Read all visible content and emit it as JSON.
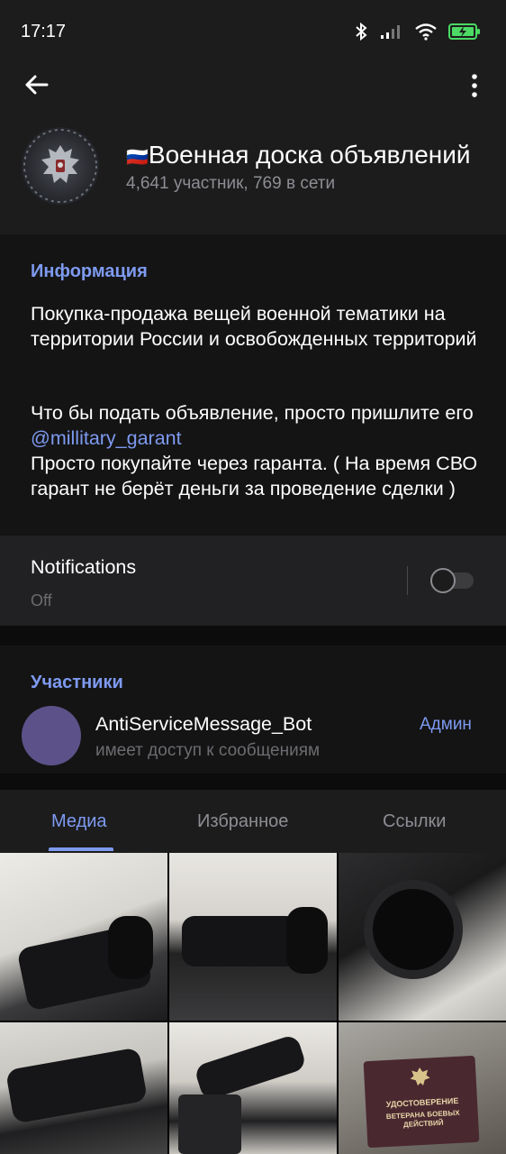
{
  "status_bar": {
    "time": "17:17",
    "icons": [
      "bluetooth-icon",
      "signal-icon",
      "wifi-icon",
      "battery-charging-icon"
    ]
  },
  "header": {
    "back_icon": "arrow-left-icon",
    "more_icon": "more-vertical-icon",
    "flag": "🇷🇺",
    "title": "Военная доска объявлений",
    "subtitle": "4,641 участник, 769 в сети"
  },
  "info": {
    "heading": "Информация",
    "description_1": "Покупка-продажа вещей военной тематики на территории России и освобожденных территорий",
    "description_2_before": "Что бы подать объявление, просто пришлите его ",
    "description_2_link": "@millitary_garant",
    "description_2_after": "Просто покупайте через гаранта. ( На время СВО гарант не берёт деньги за проведение сделки )"
  },
  "notifications": {
    "title": "Notifications",
    "value": "Off",
    "enabled": false
  },
  "members": {
    "heading": "Участники",
    "items": [
      {
        "name": "AntiServiceMessage_Bot",
        "status": "имеет доступ к сообщениям",
        "role": "Админ",
        "avatar_color": "#5c5289"
      }
    ]
  },
  "tabs": {
    "items": [
      "Медиа",
      "Избранное",
      "Ссылки"
    ],
    "active": "Медиа"
  },
  "media": {
    "id_card_line1": "УДОСТОВЕРЕНИЕ",
    "id_card_line2": "ВЕТЕРАНА БОЕВЫХ ДЕЙСТВИЙ"
  },
  "colors": {
    "accent": "#7e9af0",
    "background": "#1c1c1d",
    "section_bg": "#141414"
  }
}
